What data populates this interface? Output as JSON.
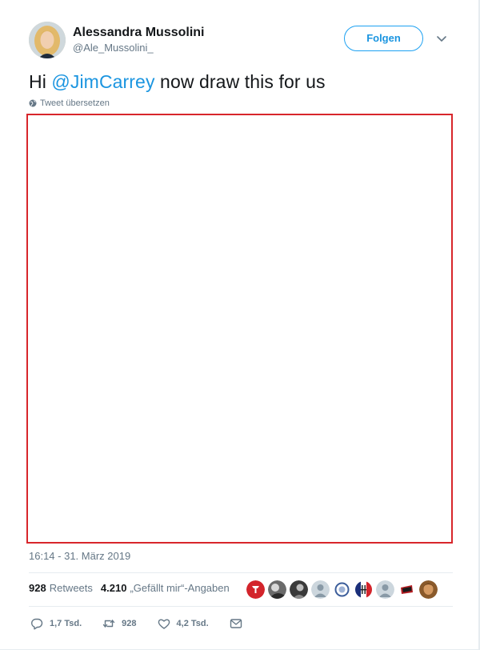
{
  "user": {
    "name": "Alessandra Mussolini",
    "handle": "@Ale_Mussolini_",
    "follow_label": "Folgen"
  },
  "tweet": {
    "text_before": "Hi ",
    "mention": "@JimCarrey",
    "text_after": " now draw this for us",
    "translate_label": "Tweet übersetzen",
    "timestamp": "16:14 - 31. März 2019"
  },
  "stats": {
    "retweets_count": "928",
    "retweets_label": "Retweets",
    "likes_count": "4.210",
    "likes_label": "„Gefällt mir“-Angaben"
  },
  "liker_avatars": [
    {
      "kind": "red-logo"
    },
    {
      "kind": "photo-bw"
    },
    {
      "kind": "photo-bw"
    },
    {
      "kind": "default"
    },
    {
      "kind": "emblem-blue"
    },
    {
      "kind": "tricolor-logo"
    },
    {
      "kind": "default"
    },
    {
      "kind": "red-flag"
    },
    {
      "kind": "photo-brown"
    }
  ],
  "actions": {
    "reply_count": "1,7 Tsd.",
    "retweet_count": "928",
    "like_count": "4,2 Tsd."
  },
  "colors": {
    "accent": "#1da1f2",
    "link": "#1b95e0",
    "muted": "#657786",
    "media_border": "#d8262b"
  }
}
